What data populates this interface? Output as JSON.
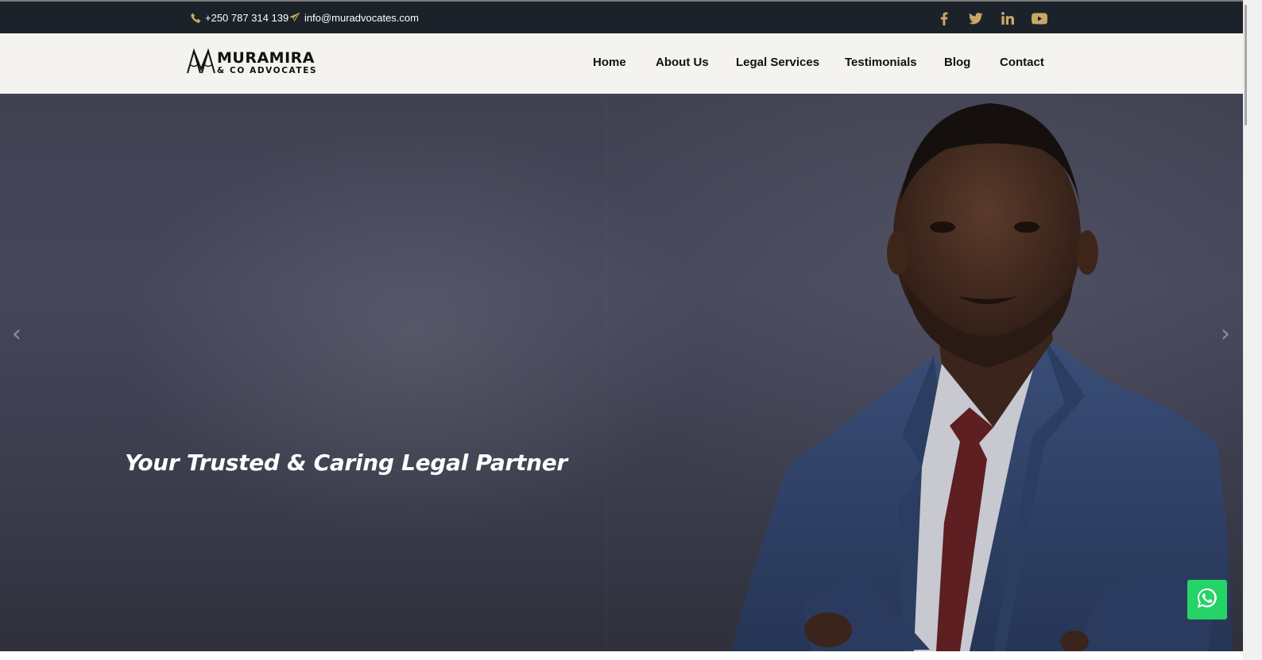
{
  "topbar": {
    "phone": "+250 787 314 139",
    "email": "info@muradvocates.com",
    "icons": {
      "phone": "phone-icon",
      "email": "paper-plane-icon"
    },
    "social": [
      "facebook-icon",
      "twitter-icon",
      "linkedin-icon",
      "youtube-icon"
    ],
    "accent": "#c9a865"
  },
  "header": {
    "logo": {
      "name": "MURAMIRA",
      "sub": "& CO ADVOCATES"
    },
    "nav": [
      "Home",
      "About Us",
      "Legal Services",
      "Testimonials",
      "Blog",
      "Contact"
    ]
  },
  "hero": {
    "heading": "Your Trusted & Caring Legal Partner",
    "prev": "‹",
    "next": "›"
  },
  "whatsapp": {
    "icon": "whatsapp-icon",
    "color": "#25d366"
  }
}
